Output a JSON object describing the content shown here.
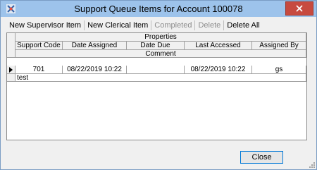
{
  "window": {
    "title": "Support Queue Items for Account 100078",
    "title_bar_color": "#9dc3eb",
    "close_button_color": "#c74a3f"
  },
  "toolbar": {
    "new_supervisor_item": "New Supervisor Item",
    "new_clerical_item": "New Clerical Item",
    "completed": "Completed",
    "delete": "Delete",
    "delete_all": "Delete All"
  },
  "grid": {
    "band_header": "Properties",
    "columns": [
      "Support Code",
      "Date Assigned",
      "Date Due",
      "Last Accessed",
      "Assigned By"
    ],
    "comment_header": "Comment",
    "rows": [
      {
        "support_code": "701",
        "date_assigned": "08/22/2019  10:22",
        "date_due": "",
        "last_accessed": "08/22/2019  10:22",
        "assigned_by": "gs",
        "comment": "test"
      }
    ]
  },
  "footer": {
    "close_label": "Close"
  }
}
